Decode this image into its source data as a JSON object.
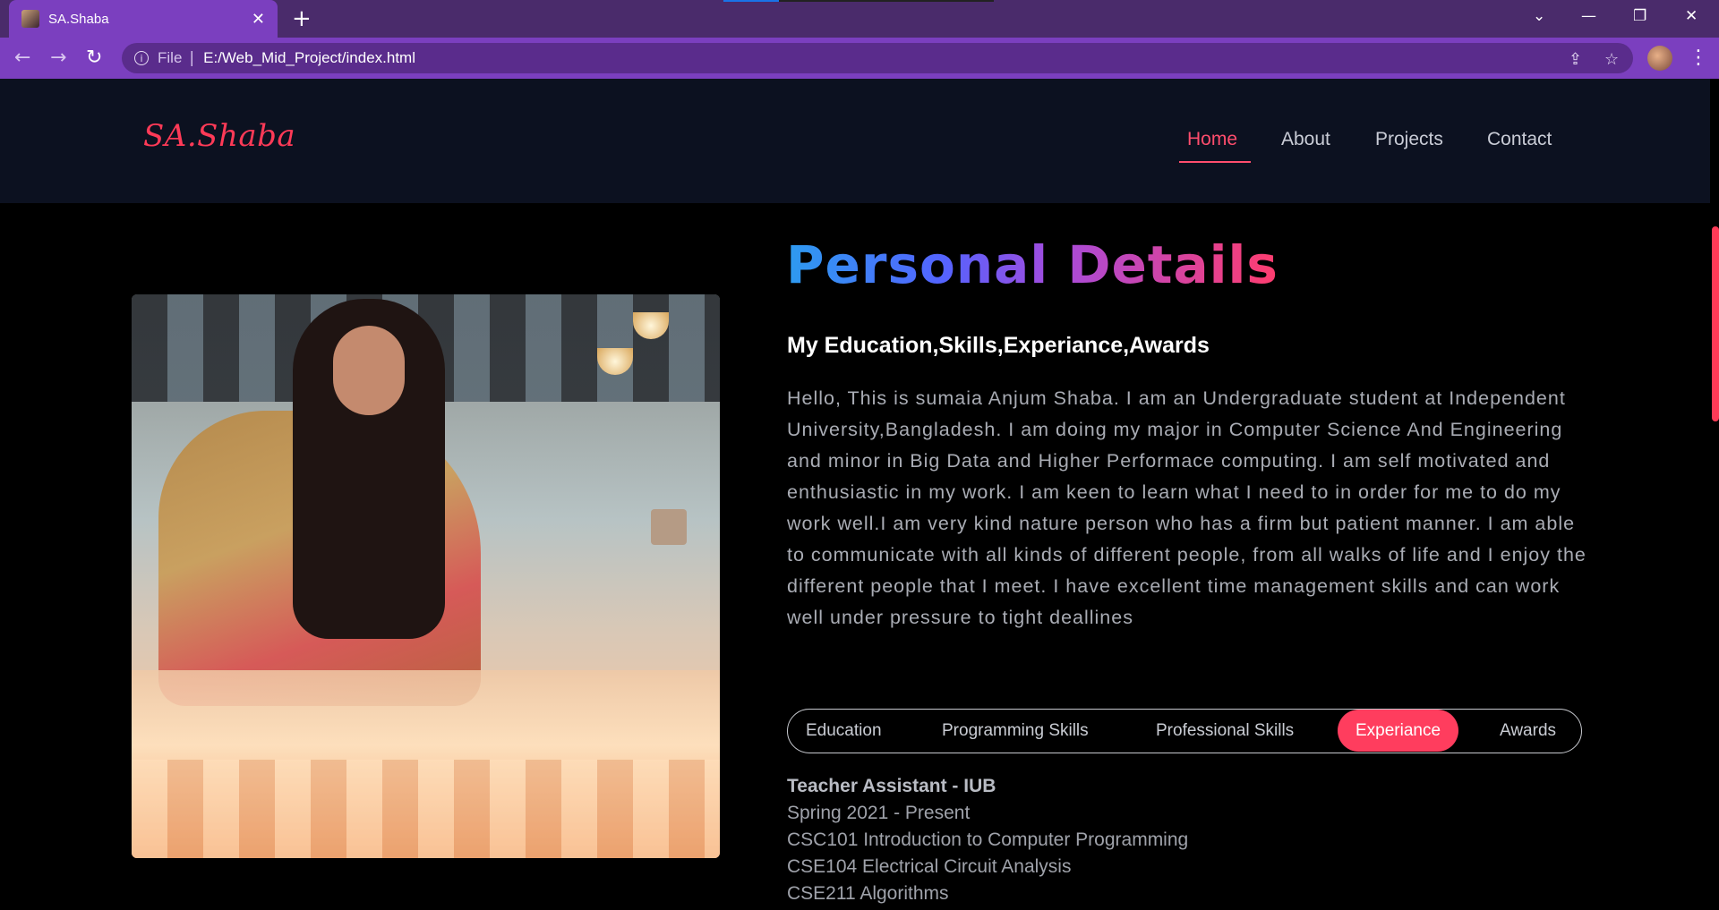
{
  "browser": {
    "tab_title": "SA.Shaba",
    "url_scheme": "File",
    "url": "E:/Web_Mid_Project/index.html"
  },
  "site": {
    "logo": "SA.Shaba",
    "nav": [
      "Home",
      "About",
      "Projects",
      "Contact"
    ],
    "active_nav": "Home"
  },
  "about": {
    "heading": "Personal Details",
    "subheading": "My Education,Skills,Experiance,Awards",
    "bio": "Hello, This is sumaia Anjum Shaba. I am an Undergraduate student at Independent University,Bangladesh. I am doing my major in Computer Science And Engineering and minor in Big Data and Higher Performace computing. I am self motivated and enthusiastic in my work. I am keen to learn what I need to in order for me to do my work well.I am very kind nature person who has a firm but patient manner. I am able to communicate with all kinds of different people, from all walks of life and I enjoy the different people that I meet. I have excellent time management skills and can work well under pressure to tight deallines",
    "tabs": [
      "Education",
      "Programming Skills",
      "Professional Skills",
      "Experiance",
      "Awards"
    ],
    "active_tab": "Experiance"
  },
  "experience": {
    "role": "Teacher Assistant - IUB",
    "period": "Spring 2021 - Present",
    "courses": [
      "CSC101 Introduction to Computer Programming",
      "CSE104 Electrical Circuit Analysis",
      "CSE211 Algorithms"
    ]
  },
  "colors": {
    "accent": "#ff3d5e",
    "header_bg": "#0c1120",
    "browser_purple": "#7b3fbf"
  },
  "icons": [
    "back-icon",
    "forward-icon",
    "reload-icon",
    "info-icon",
    "share-icon",
    "star-icon",
    "kebab-menu-icon"
  ]
}
